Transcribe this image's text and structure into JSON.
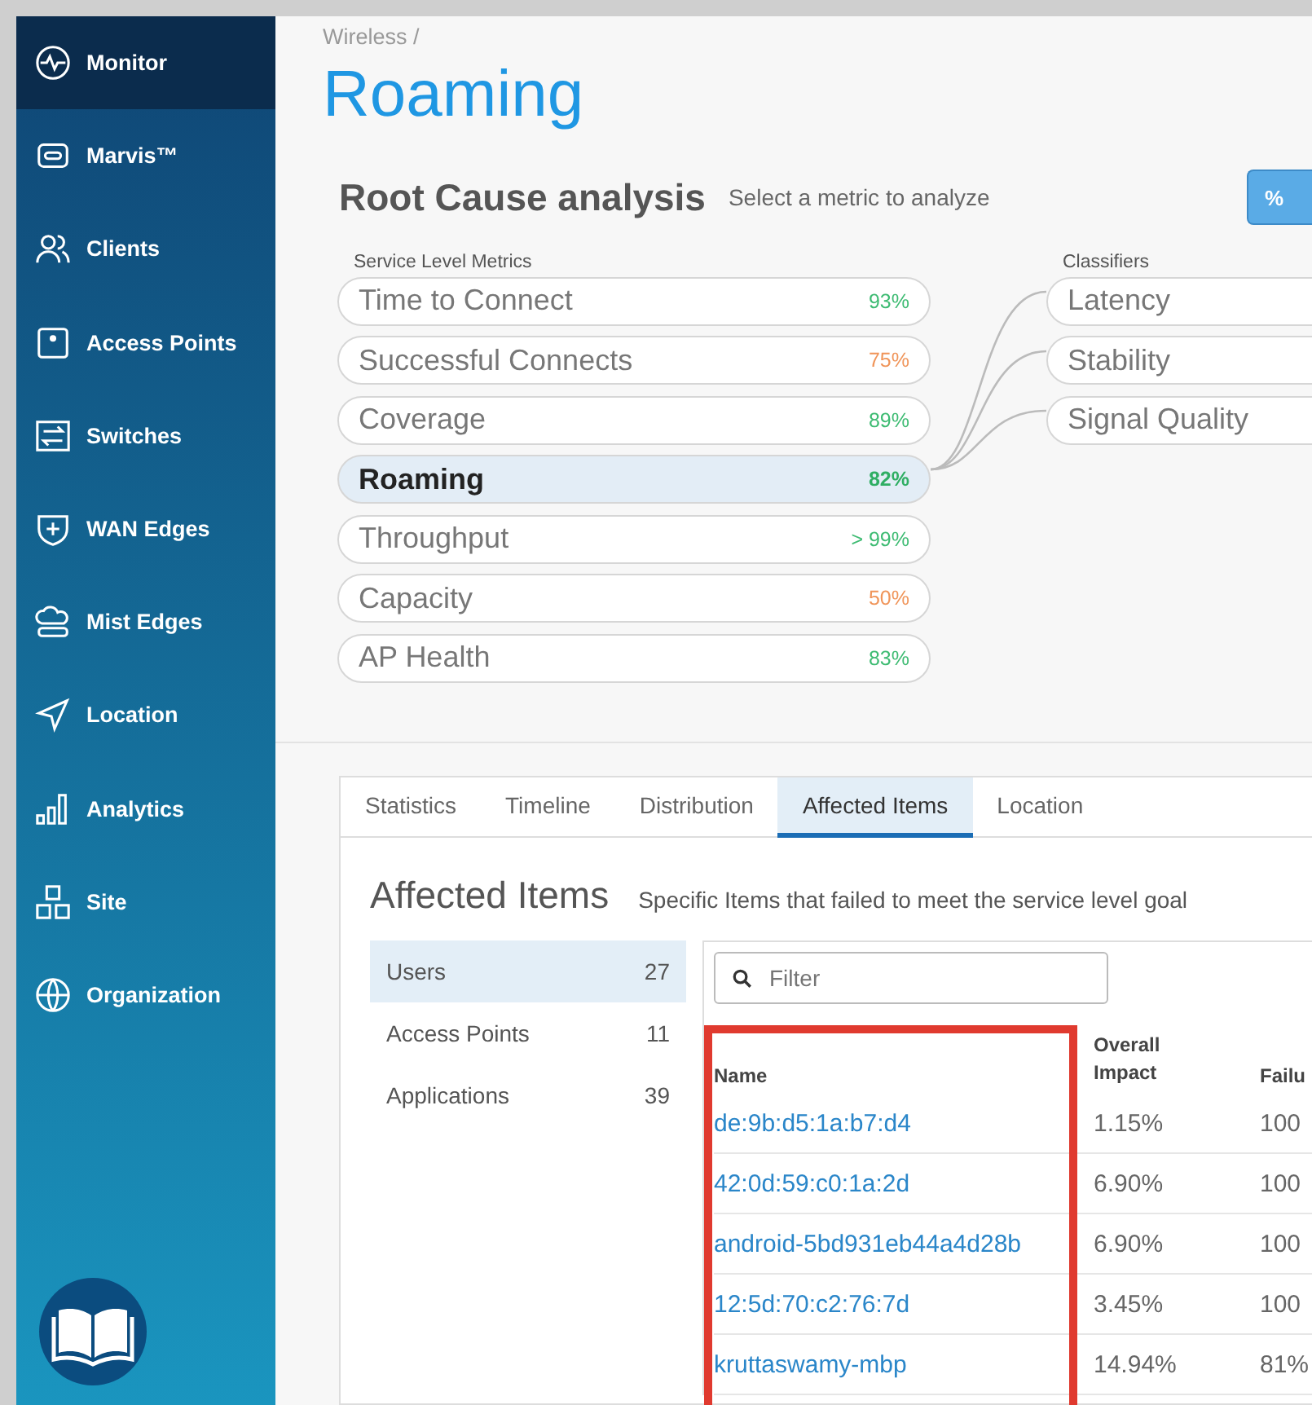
{
  "sidebar": {
    "items": [
      {
        "label": "Monitor",
        "selected": true
      },
      {
        "label": "Marvis™",
        "selected": false
      },
      {
        "label": "Clients",
        "selected": false
      },
      {
        "label": "Access Points",
        "selected": false
      },
      {
        "label": "Switches",
        "selected": false
      },
      {
        "label": "WAN Edges",
        "selected": false
      },
      {
        "label": "Mist Edges",
        "selected": false
      },
      {
        "label": "Location",
        "selected": false
      },
      {
        "label": "Analytics",
        "selected": false
      },
      {
        "label": "Site",
        "selected": false
      },
      {
        "label": "Organization",
        "selected": false
      }
    ]
  },
  "breadcrumb": "Wireless /",
  "title": "Roaming",
  "analysis": {
    "heading": "Root Cause analysis",
    "subtitle": "Select a metric to analyze",
    "button": "%"
  },
  "metrics": {
    "label": "Service Level Metrics",
    "items": [
      {
        "name": "Time to Connect",
        "value": "93%",
        "color": "#3dbb72",
        "selected": false
      },
      {
        "name": "Successful Connects",
        "value": "75%",
        "color": "#f0955a",
        "selected": false
      },
      {
        "name": "Coverage",
        "value": "89%",
        "color": "#3dbb72",
        "selected": false
      },
      {
        "name": "Roaming",
        "value": "82%",
        "color": "#2fae63",
        "selected": true
      },
      {
        "name": "Throughput",
        "value": "> 99%",
        "color": "#3dbb72",
        "selected": false
      },
      {
        "name": "Capacity",
        "value": "50%",
        "color": "#f0955a",
        "selected": false
      },
      {
        "name": "AP Health",
        "value": "83%",
        "color": "#3dbb72",
        "selected": false
      }
    ]
  },
  "classifiers": {
    "label": "Classifiers",
    "items": [
      "Latency",
      "Stability",
      "Signal Quality"
    ]
  },
  "tabs": [
    {
      "label": "Statistics",
      "selected": false
    },
    {
      "label": "Timeline",
      "selected": false
    },
    {
      "label": "Distribution",
      "selected": false
    },
    {
      "label": "Affected Items",
      "selected": true
    },
    {
      "label": "Location",
      "selected": false
    }
  ],
  "affected": {
    "heading": "Affected Items",
    "subtitle": "Specific Items that failed to meet the service level goal",
    "categories": [
      {
        "label": "Users",
        "count": "27",
        "selected": true
      },
      {
        "label": "Access Points",
        "count": "11",
        "selected": false
      },
      {
        "label": "Applications",
        "count": "39",
        "selected": false
      }
    ],
    "filter": {
      "placeholder": "Filter"
    },
    "table": {
      "columns": [
        "Name",
        "Overall Impact",
        "Failu"
      ],
      "rows": [
        [
          "de:9b:d5:1a:b7:d4",
          "1.15%",
          "100"
        ],
        [
          "42:0d:59:c0:1a:2d",
          "6.90%",
          "100"
        ],
        [
          "android-5bd931eb44a4d28b",
          "6.90%",
          "100"
        ],
        [
          "12:5d:70:c2:76:7d",
          "3.45%",
          "100"
        ],
        [
          "kruttaswamy-mbp",
          "14.94%",
          "81%"
        ]
      ]
    }
  }
}
